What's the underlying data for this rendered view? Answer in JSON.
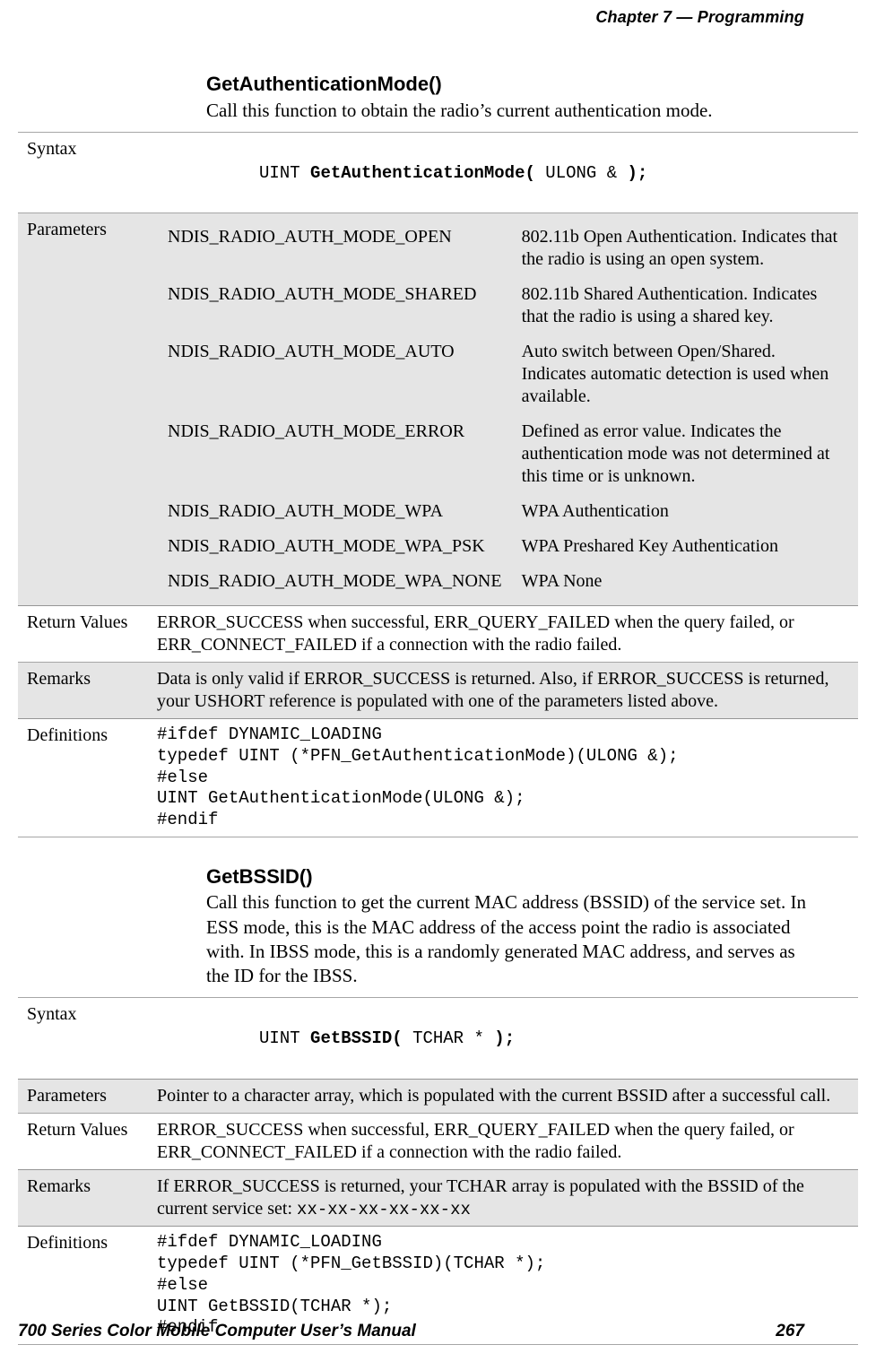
{
  "header": {
    "chapter": "Chapter 7 — Programming"
  },
  "sections": [
    {
      "id": "getauth",
      "title": "GetAuthenticationMode()",
      "intro": "Call this function to obtain the radio’s current authentication mode.",
      "rows": {
        "syntax_label": "Syntax",
        "syntax_code_pre": "UINT ",
        "syntax_code_bold": "GetAuthenticationMode(",
        "syntax_code_mid": " ULONG & ",
        "syntax_code_bold_end": ");",
        "parameters_label": "Parameters",
        "parameters": [
          {
            "name": "NDIS_RADIO_AUTH_MODE_OPEN",
            "desc": "802.11b Open Authentication. Indicates that the radio is using an open system."
          },
          {
            "name": "NDIS_RADIO_AUTH_MODE_SHARED",
            "desc": "802.11b Shared Authentication. Indicates that the radio is using a shared key."
          },
          {
            "name": "NDIS_RADIO_AUTH_MODE_AUTO",
            "desc": "Auto switch between Open/Shared. Indicates automatic detection is used when available."
          },
          {
            "name": "NDIS_RADIO_AUTH_MODE_ERROR",
            "desc": "Defined as error value. Indicates the authentication mode was not determined at this time or is unknown."
          },
          {
            "name": "NDIS_RADIO_AUTH_MODE_WPA",
            "desc": "WPA Authentication"
          },
          {
            "name": "NDIS_RADIO_AUTH_MODE_WPA_PSK",
            "desc": "WPA Preshared Key Authentication"
          },
          {
            "name": "NDIS_RADIO_AUTH_MODE_WPA_NONE",
            "desc": "WPA None"
          }
        ],
        "return_label": "Return Values",
        "return_text": "ERROR_SUCCESS when successful, ERR_QUERY_FAILED when the query failed, or ERR_CONNECT_FAILED if a connection with the radio failed.",
        "remarks_label": "Remarks",
        "remarks_text": "Data is only valid if ERROR_SUCCESS is returned. Also, if ERROR_SUCCESS is returned, your USHORT reference is populated with one of the parameters listed above.",
        "definitions_label": "Definitions",
        "definitions_code": "#ifdef DYNAMIC_LOADING\ntypedef UINT (*PFN_GetAuthenticationMode)(ULONG &);\n#else\nUINT GetAuthenticationMode(ULONG &);\n#endif"
      }
    },
    {
      "id": "getbssid",
      "title": "GetBSSID()",
      "intro": "Call this function to get the current MAC address (BSSID) of the service set. In ESS mode, this is the MAC address of the access point the radio is associated with. In IBSS mode, this is a randomly generated MAC address, and serves as the ID for the IBSS.",
      "rows": {
        "syntax_label": "Syntax",
        "syntax_code_pre": "UINT ",
        "syntax_code_bold": "GetBSSID(",
        "syntax_code_mid": " TCHAR * ",
        "syntax_code_bold_end": ");",
        "parameters_label": "Parameters",
        "parameters_text": "Pointer to a character array, which is populated with the current BSSID after a successful call.",
        "return_label": "Return Values",
        "return_text": "ERROR_SUCCESS when successful, ERR_QUERY_FAILED when the query failed, or ERR_CONNECT_FAILED if a connection with the radio failed.",
        "remarks_label": "Remarks",
        "remarks_text_pre": "If ERROR_SUCCESS is returned, your TCHAR array is populated with the BSSID of the current service set: ",
        "remarks_text_code": "xx-xx-xx-xx-xx-xx",
        "definitions_label": "Definitions",
        "definitions_code": "#ifdef DYNAMIC_LOADING\ntypedef UINT (*PFN_GetBSSID)(TCHAR *);\n#else\nUINT GetBSSID(TCHAR *);\n#endif"
      }
    }
  ],
  "footer": {
    "left": "700 Series Color Mobile Computer User’s Manual",
    "right": "267"
  }
}
